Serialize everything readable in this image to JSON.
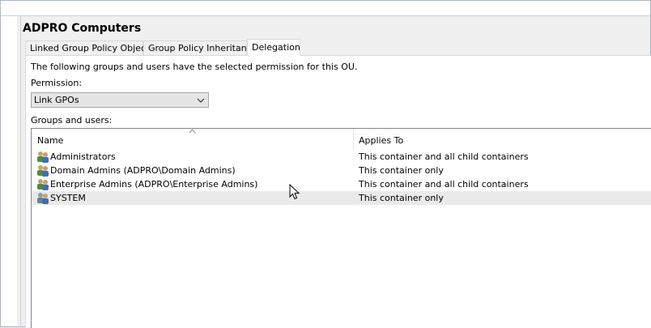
{
  "page": {
    "title": "ADPRO Computers"
  },
  "tabs": [
    {
      "label": "Linked Group Policy Objects",
      "active": false
    },
    {
      "label": "Group Policy Inheritance",
      "active": false
    },
    {
      "label": "Delegation",
      "active": true
    }
  ],
  "delegation": {
    "description": "The following groups and users have the selected permission for this OU.",
    "permission_label": "Permission:",
    "permission_value": "Link GPOs",
    "groups_label": "Groups and users:",
    "columns": {
      "name": "Name",
      "applies_to": "Applies To"
    },
    "rows": [
      {
        "name": "Administrators",
        "applies_to": "This container and all child containers",
        "icon": "group-icon"
      },
      {
        "name": "Domain Admins (ADPRO\\Domain Admins)",
        "applies_to": "This container only",
        "icon": "group-icon"
      },
      {
        "name": "Enterprise Admins (ADPRO\\Enterprise Admins)",
        "applies_to": "This container and all child containers",
        "icon": "group-icon"
      },
      {
        "name": "SYSTEM",
        "applies_to": "This container only",
        "icon": "group-icon",
        "hovered": true
      }
    ]
  },
  "colors": {
    "window_bg": "#f0f0f0",
    "panel_bg": "#ffffff",
    "hover_row": "#eaeaea",
    "border": "#a9b6c2"
  }
}
